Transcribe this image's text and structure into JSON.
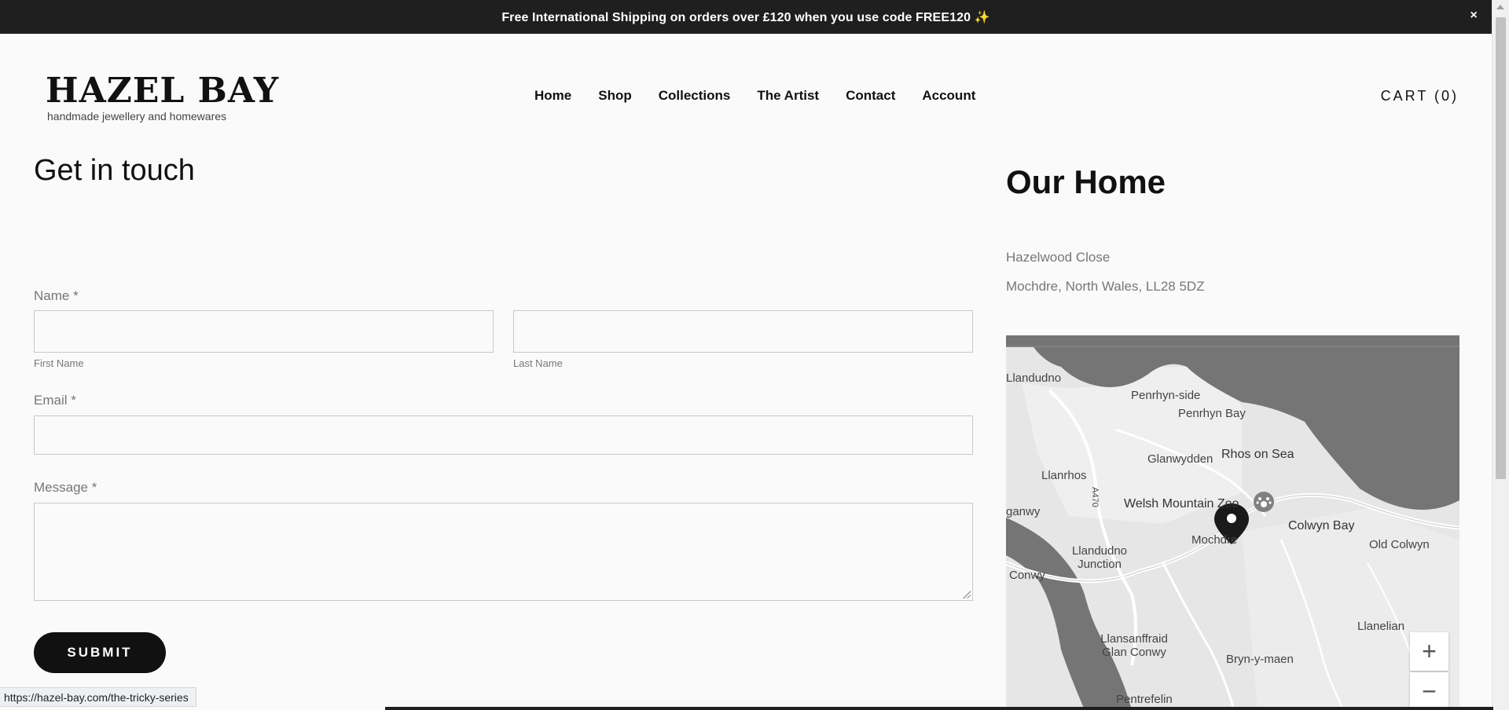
{
  "announcement": {
    "text": "Free International Shipping on orders over £120 when you use code FREE120 ✨",
    "close": "×"
  },
  "brand": {
    "name": "HAZEL BAY",
    "tagline": "handmade jewellery and homewares"
  },
  "nav": [
    "Home",
    "Shop",
    "Collections",
    "The Artist",
    "Contact",
    "Account"
  ],
  "cart": "CART (0)",
  "form": {
    "heading": "Get in touch",
    "name_label": "Name *",
    "first_name": "First Name",
    "last_name": "Last Name",
    "email_label": "Email *",
    "message_label": "Message *",
    "submit": "SUBMIT"
  },
  "home": {
    "heading": "Our Home",
    "address_line1": "Hazelwood Close",
    "address_line2": "Mochdre, North Wales, LL28 5DZ"
  },
  "map": {
    "labels": [
      "Llandudno",
      "Penrhyn-side",
      "Penrhyn Bay",
      "Glanwydden",
      "Rhos on Sea",
      "Llanrhos",
      "A470",
      "Welsh Mountain Zoo",
      "ganwy",
      "Colwyn Bay",
      "Mochdre",
      "Old Colwyn",
      "Llandudno Junction",
      "Conwy",
      "Llanelian",
      "Llansanffraid Glan Conwy",
      "Bryn-y-maen",
      "Pentrefelin"
    ],
    "zoom_in": "+",
    "zoom_out": "−"
  },
  "status_url": "https://hazel-bay.com/the-tricky-series"
}
